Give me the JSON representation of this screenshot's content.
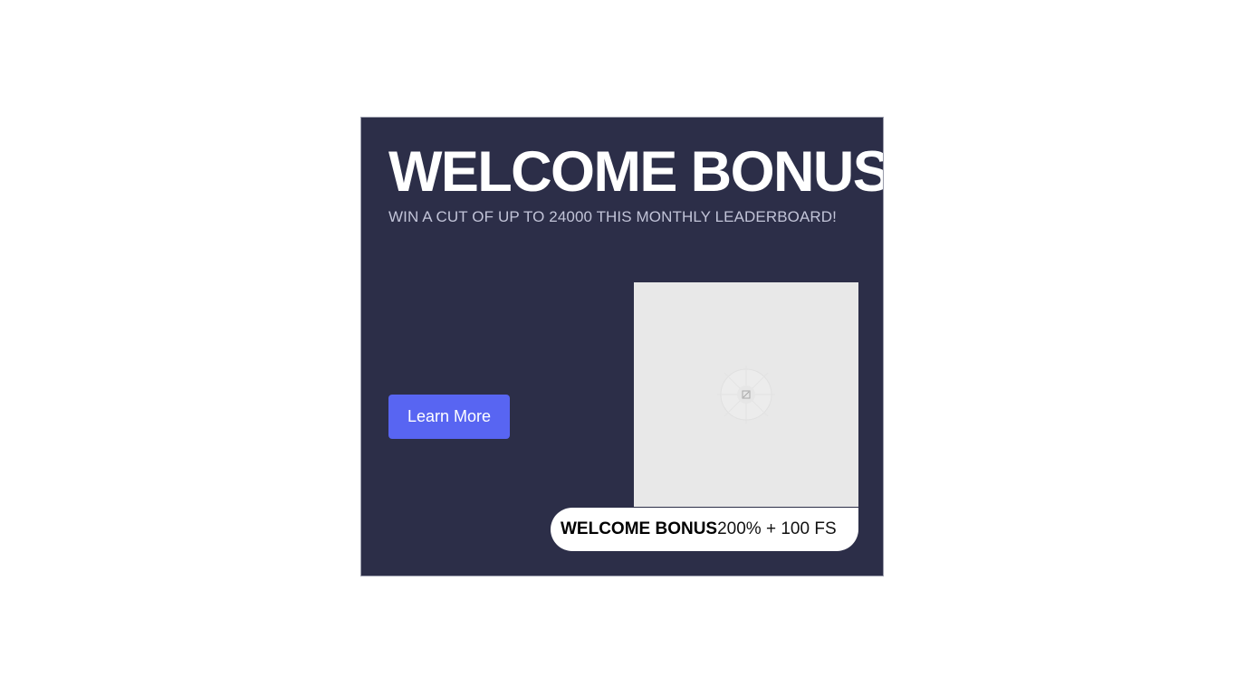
{
  "banner": {
    "headline": "WELCOME BONUS",
    "subline": "WIN A CUT OF UP TO 24000 THIS MONTHLY LEADERBOARD!",
    "cta_label": "Learn More",
    "offer": {
      "title": "WELCOME BONUS",
      "value": "200% + 100 FS"
    },
    "image_icon": "broken-image-icon"
  },
  "colors": {
    "background": "#2c2e48",
    "accent": "#5865f2",
    "placeholder": "#e8e8e8"
  }
}
